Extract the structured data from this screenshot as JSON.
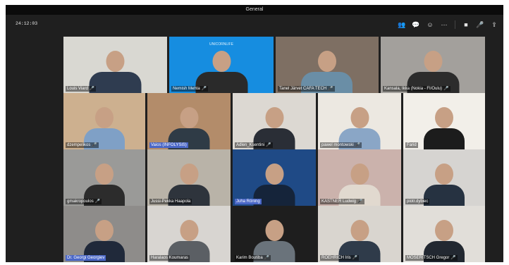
{
  "window": {
    "title": "General"
  },
  "meeting": {
    "timer": "24:12:03"
  },
  "toolbar": {
    "icons": [
      "people-icon",
      "chat-icon",
      "react-icon",
      "more-icon",
      "camera-icon",
      "mic-icon",
      "share-icon"
    ],
    "glyphs": [
      "👥",
      "💬",
      "☺",
      "⋯",
      "■",
      "🎤",
      "⇪"
    ]
  },
  "participants": [
    {
      "name": "Louis Viard",
      "mic": true,
      "active": false,
      "bg": "#d9d8d2",
      "shirt": "#2f3c50"
    },
    {
      "name": "Nemish Mehta",
      "mic": true,
      "active": false,
      "bg": "#168de0",
      "shirt": "#2a2a2a",
      "logo": "UNICORNLIFE"
    },
    {
      "name": "Tanel Järvet CAFA TECH",
      "mic": true,
      "active": false,
      "bg": "#7e6f63",
      "shirt": "#6a8ea6"
    },
    {
      "name": "Kansala, Ikka (Nokia - FI/Oulu)",
      "mic": true,
      "active": false,
      "bg": "#a3a09c",
      "shirt": "#2c2c2c"
    },
    {
      "name": "dzempelikos",
      "mic": true,
      "active": false,
      "bg": "#cdb08f",
      "shirt": "#7fa0c6"
    },
    {
      "name": "Vaios (INFOLYSiS)",
      "mic": false,
      "active": true,
      "bg": "#b38c6a",
      "shirt": "#2f3b46"
    },
    {
      "name": "Adlen_Ksentini",
      "mic": true,
      "active": false,
      "bg": "#dcd8d2",
      "shirt": "#2a2e36"
    },
    {
      "name": "pawel montowski",
      "mic": true,
      "active": false,
      "bg": "#ece8e1",
      "shirt": "#8aa6c6"
    },
    {
      "name": "Farid",
      "mic": false,
      "active": false,
      "bg": "#f2efe9",
      "shirt": "#1c1c1c"
    },
    {
      "name": "gmakropoulos",
      "mic": true,
      "active": false,
      "bg": "#9a9a98",
      "shirt": "#2c2c2c"
    },
    {
      "name": "Jussi-Pekka Haapola",
      "mic": false,
      "active": false,
      "bg": "#b9b3a8",
      "shirt": "#2e343c"
    },
    {
      "name": "Juha Röning",
      "mic": false,
      "active": true,
      "bg": "#1f4a86",
      "shirt": "#15243a"
    },
    {
      "name": "KASTNER Ludwig",
      "mic": true,
      "active": false,
      "bg": "#cbb2ac",
      "shirt": "#e1d9cf"
    },
    {
      "name": "piotr.dybiec",
      "mic": false,
      "active": false,
      "bg": "#d6d4d1",
      "shirt": "#263241"
    },
    {
      "name": "Dr. Georgi Georgiev",
      "mic": false,
      "active": true,
      "bg": "#8e8c8a",
      "shirt": "#20293a"
    },
    {
      "name": "Haralaos Koumaras",
      "mic": false,
      "active": false,
      "bg": "#d8d5d1",
      "shirt": "#5b5f64"
    },
    {
      "name": "Karim Boutiba",
      "mic": true,
      "active": false,
      "bg": "#1e1e1e",
      "shirt": "#6a737b"
    },
    {
      "name": "ROEHRICH Iris",
      "mic": true,
      "active": false,
      "bg": "#d9d5cf",
      "shirt": "#2f3b4a"
    },
    {
      "name": "MOSERITSCH Gregor",
      "mic": true,
      "active": false,
      "bg": "#e1ded9",
      "shirt": "#222831"
    }
  ],
  "mic_glyph": "🎤"
}
